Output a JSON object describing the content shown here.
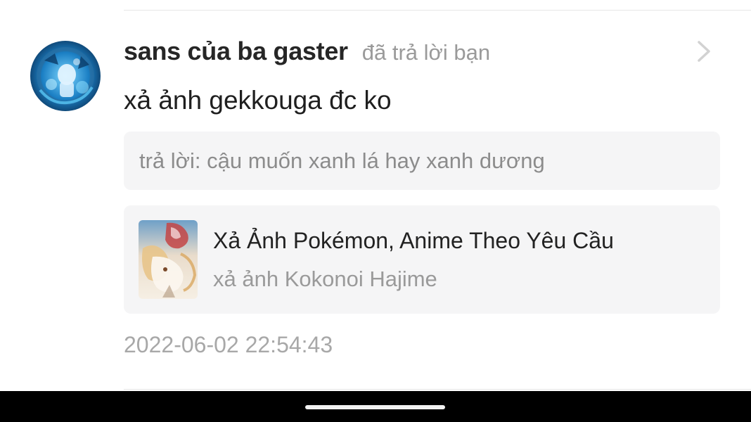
{
  "notification": {
    "user_name": "sans của ba gaster",
    "action_text": "đã trả lời bạn",
    "comment": "xả ảnh gekkouga đc ko",
    "quoted_reply": "trả lời: cậu muốn xanh lá hay xanh dương",
    "post": {
      "title": "Xả Ảnh Pokémon, Anime Theo Yêu Cầu",
      "subtitle": "xả ảnh Kokonoi Hajime"
    },
    "timestamp": "2022-06-02 22:54:43"
  },
  "icons": {
    "avatar": "avatar-image",
    "chevron": "chevron-right-icon",
    "thumbnail": "post-cover-thumbnail"
  },
  "colors": {
    "name": "#262626",
    "muted": "#9a9a9a",
    "card_background": "#f5f5f6",
    "nav_bar": "#000000"
  }
}
